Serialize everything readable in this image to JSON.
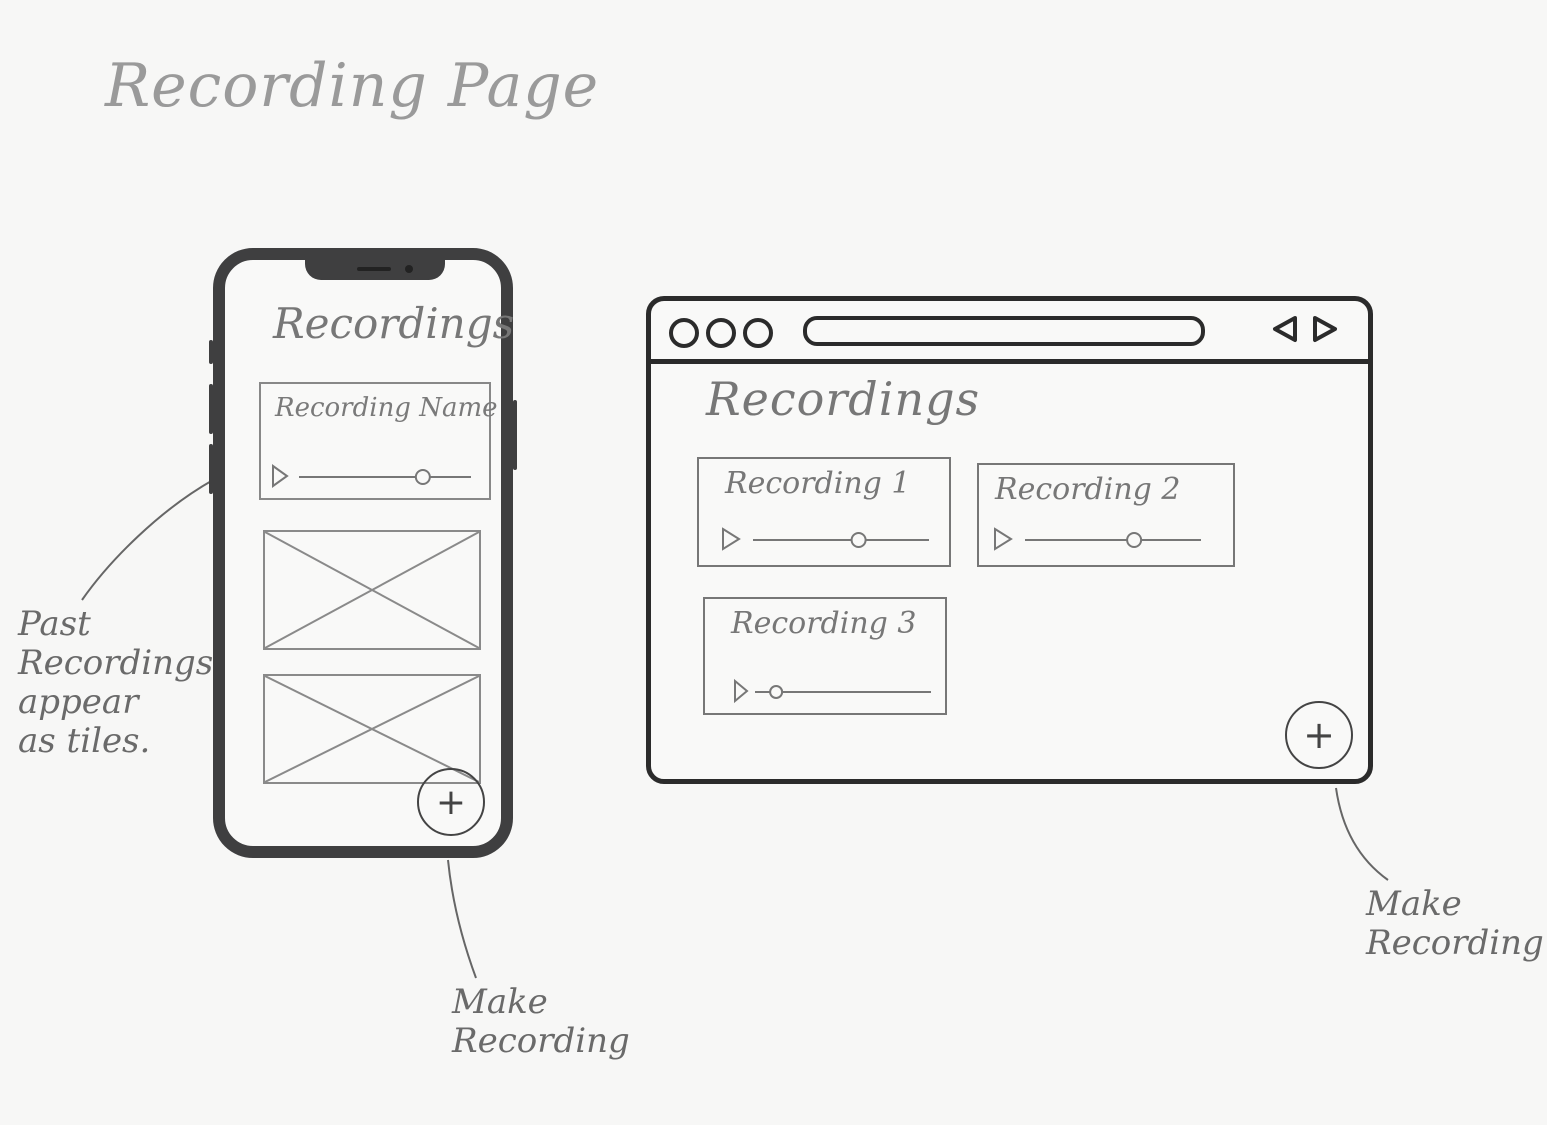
{
  "page_title": "Recording Page",
  "annotations": {
    "past_recordings": "Past\nRecordings\nappear\nas tiles.",
    "make_recording_mobile": "Make\nRecording",
    "make_recording_desktop": "Make\nRecording"
  },
  "mobile": {
    "heading": "Recordings",
    "recording_card": {
      "name": "Recording Name",
      "progress": 0.72
    },
    "fab_label": "+"
  },
  "desktop": {
    "heading": "Recordings",
    "recordings": [
      {
        "name": "Recording 1",
        "progress": 0.6
      },
      {
        "name": "Recording 2",
        "progress": 0.62
      },
      {
        "name": "Recording 3",
        "progress": 0.12
      }
    ],
    "fab_label": "+"
  },
  "colors": {
    "ink": "#2b2b2b",
    "pencil": "#777777",
    "paper": "#f7f7f6"
  }
}
